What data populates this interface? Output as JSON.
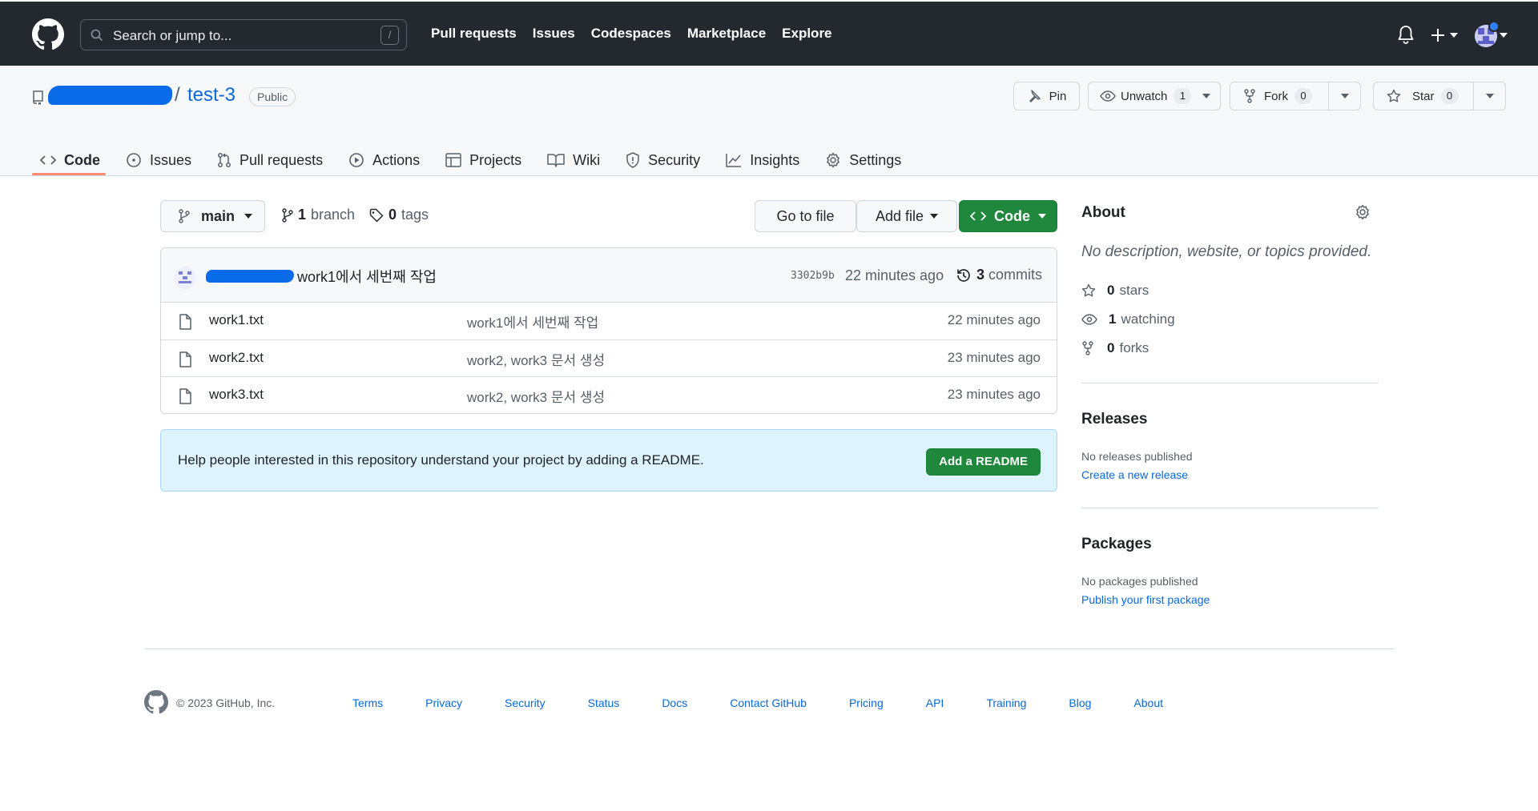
{
  "header": {
    "search_placeholder": "Search or jump to...",
    "search_shortcut": "/",
    "nav": [
      "Pull requests",
      "Issues",
      "Codespaces",
      "Marketplace",
      "Explore"
    ]
  },
  "repo": {
    "name": "test-3",
    "separator": "/",
    "visibility": "Public",
    "pin_label": "Pin",
    "unwatch_label": "Unwatch",
    "watch_count": "1",
    "fork_label": "Fork",
    "fork_count": "0",
    "star_label": "Star",
    "star_count": "0"
  },
  "tabs": [
    {
      "label": "Code",
      "icon": "code-icon"
    },
    {
      "label": "Issues",
      "icon": "issue-icon"
    },
    {
      "label": "Pull requests",
      "icon": "pull-request-icon"
    },
    {
      "label": "Actions",
      "icon": "play-icon"
    },
    {
      "label": "Projects",
      "icon": "table-icon"
    },
    {
      "label": "Wiki",
      "icon": "book-icon"
    },
    {
      "label": "Security",
      "icon": "shield-icon"
    },
    {
      "label": "Insights",
      "icon": "graph-icon"
    },
    {
      "label": "Settings",
      "icon": "gear-icon"
    }
  ],
  "toolbar": {
    "branch": "main",
    "branch_count": "1",
    "branch_word": "branch",
    "tag_count": "0",
    "tag_word": "tags",
    "goto_file": "Go to file",
    "add_file": "Add file",
    "code": "Code"
  },
  "latest_commit": {
    "message": "work1에서 세번째 작업",
    "sha": "3302b9b",
    "time": "22 minutes ago",
    "commit_count": "3",
    "commit_word": "commits"
  },
  "files": [
    {
      "name": "work1.txt",
      "message": "work1에서 세번째 작업",
      "time": "22 minutes ago"
    },
    {
      "name": "work2.txt",
      "message": "work2, work3 문서 생성",
      "time": "23 minutes ago"
    },
    {
      "name": "work3.txt",
      "message": "work2, work3 문서 생성",
      "time": "23 minutes ago"
    }
  ],
  "readme_banner": {
    "text": "Help people interested in this repository understand your project by adding a README.",
    "button": "Add a README"
  },
  "sidebar": {
    "about_title": "About",
    "description": "No description, website, or topics provided.",
    "stars_count": "0",
    "stars_word": "stars",
    "watching_count": "1",
    "watching_word": "watching",
    "forks_count": "0",
    "forks_word": "forks",
    "releases_title": "Releases",
    "releases_text": "No releases published",
    "releases_link": "Create a new release",
    "packages_title": "Packages",
    "packages_text": "No packages published",
    "packages_link": "Publish your first package"
  },
  "footer": {
    "copyright": "© 2023 GitHub, Inc.",
    "links": [
      "Terms",
      "Privacy",
      "Security",
      "Status",
      "Docs",
      "Contact GitHub",
      "Pricing",
      "API",
      "Training",
      "Blog",
      "About"
    ]
  },
  "colors": {
    "header_bg": "#24292f",
    "accent_green": "#1f883d",
    "link_blue": "#0969da",
    "tab_underline": "#fd8c73",
    "readme_bg": "#ddf4ff"
  }
}
